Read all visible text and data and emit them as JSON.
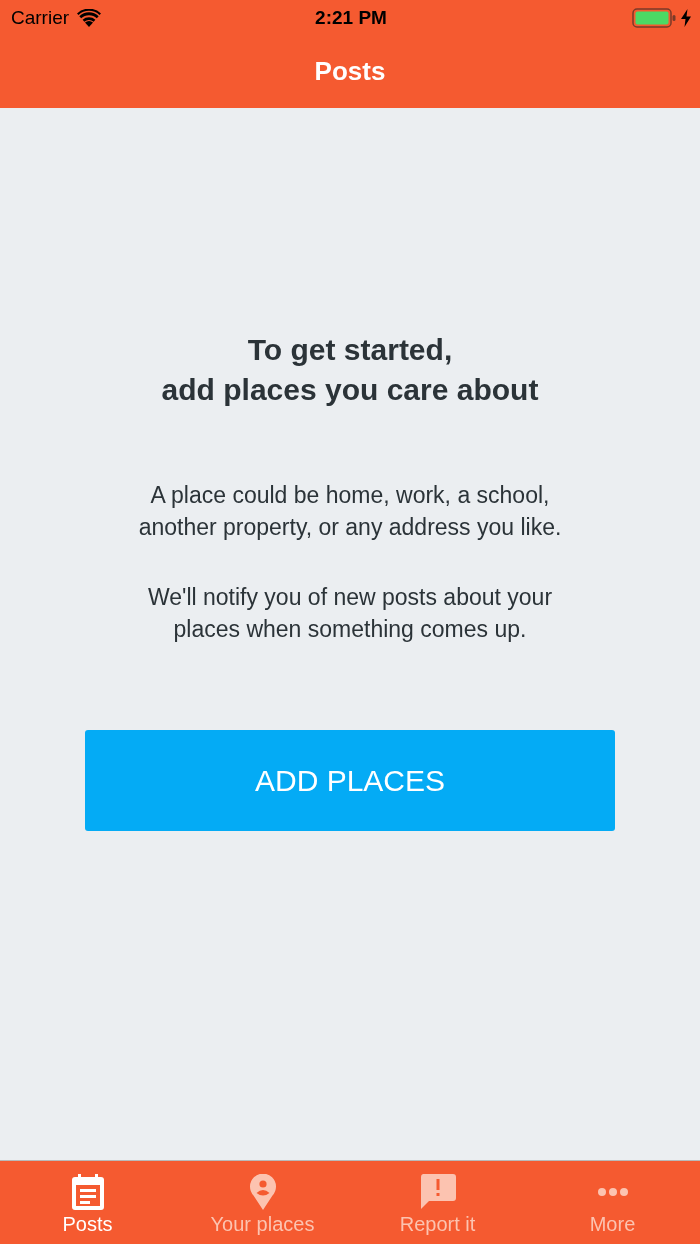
{
  "status_bar": {
    "carrier": "Carrier",
    "time": "2:21 PM"
  },
  "nav_bar": {
    "title": "Posts"
  },
  "empty_state": {
    "title": "To get started,\nadd places you care about",
    "paragraphs": [
      "A place could be home, work, a school,\nanother property, or any address you like.",
      "We'll notify you of new posts about your\nplaces when something comes up."
    ],
    "button": "ADD PLACES"
  },
  "tabs": [
    {
      "kind": "calendar",
      "label": "Posts",
      "selected": true
    },
    {
      "kind": "pin",
      "label": "Your places",
      "selected": false
    },
    {
      "kind": "alert",
      "label": "Report it",
      "selected": false
    },
    {
      "kind": "dots",
      "label": "More",
      "selected": false
    }
  ]
}
